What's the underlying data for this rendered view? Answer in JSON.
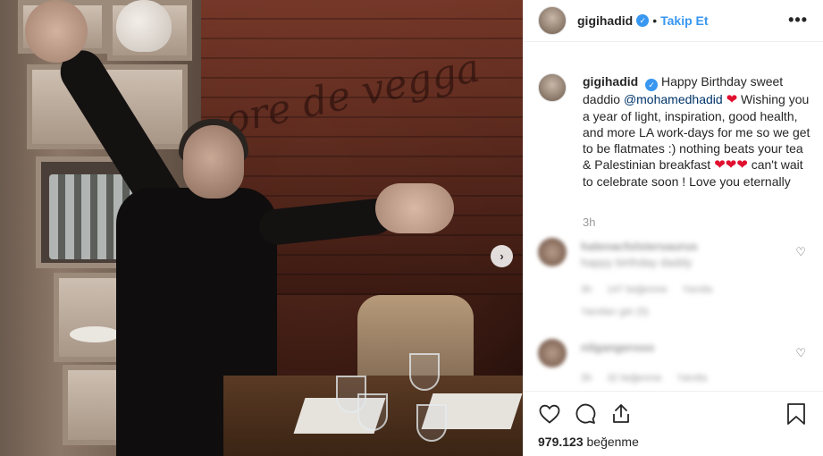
{
  "header": {
    "username": "gigihadid",
    "separator": "•",
    "follow_label": "Takip Et",
    "more_label": "•••"
  },
  "photo": {
    "graffiti_text": "ore de vegga",
    "next_label": "›"
  },
  "caption": {
    "username": "gigihadid",
    "text_1": "Happy Birthday sweet daddio",
    "mention": "@mohamedhadid",
    "text_2": "Wishing you a year of light, inspiration, good health, and more LA work-days for me so we get to be flatmates :) nothing beats your tea & Palestinian breakfast",
    "text_3": "can't wait to celebrate soon ! Love you eternally",
    "time": "3h"
  },
  "comments": [
    {
      "username": "halenacfolstersaurus",
      "text": "happy birthday daddy",
      "time": "3h",
      "likes": "147 beğenme",
      "reply": "Yanıtla",
      "view_replies": "Yanıtları gör (5)"
    },
    {
      "username": "nilgangerooo",
      "time": "3h",
      "likes": "32 beğenme",
      "reply": "Yanıtla"
    }
  ],
  "footer": {
    "likes_count": "979.123",
    "likes_label": "beğenme"
  },
  "icons": {
    "verified": "✓",
    "heart": "❤",
    "small_heart": "♡"
  },
  "colors": {
    "accent": "#3897f0",
    "heart": "#e0102f",
    "text": "#262626",
    "muted": "#999999"
  }
}
